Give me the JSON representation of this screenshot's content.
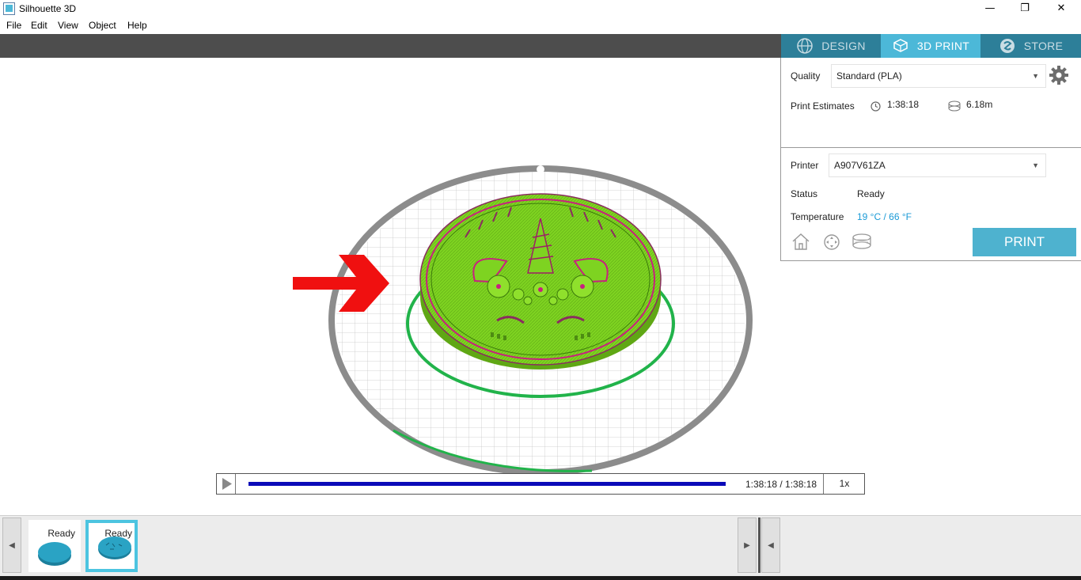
{
  "window": {
    "title": "Silhouette 3D",
    "minimize": "—",
    "maximize": "❐",
    "close": "✕"
  },
  "menu": [
    "File",
    "Edit",
    "View",
    "Object",
    "Help"
  ],
  "tabs": [
    {
      "label": "DESIGN",
      "icon": "globe-icon",
      "active": false
    },
    {
      "label": "3D PRINT",
      "icon": "printer-cube-icon",
      "active": true
    },
    {
      "label": "STORE",
      "icon": "store-logo-icon",
      "active": false
    }
  ],
  "print_settings": {
    "quality_label": "Quality",
    "quality_value": "Standard (PLA)",
    "estimates_label": "Print Estimates",
    "estimate_time": "1:38:18",
    "estimate_filament": "6.18m"
  },
  "printer": {
    "printer_label": "Printer",
    "printer_value": "A907V61ZA",
    "status_label": "Status",
    "status_value": "Ready",
    "temperature_label": "Temperature",
    "temperature_value": "19 °C / 66 °F",
    "print_button": "PRINT"
  },
  "timeline": {
    "time": "1:38:18 / 1:38:18",
    "speed": "1x",
    "progress": 1.0
  },
  "job_queue": [
    {
      "status": "Ready",
      "selected": false
    },
    {
      "status": "Ready",
      "selected": true
    }
  ],
  "colors": {
    "accent": "#4cb8d8",
    "tab_bar": "#2d7f99",
    "model": "#7ed321",
    "model_edge": "#c8207f",
    "temperature_text": "#1a9ad6",
    "progress": "#0a0ab8",
    "arrow": "#f01010"
  }
}
